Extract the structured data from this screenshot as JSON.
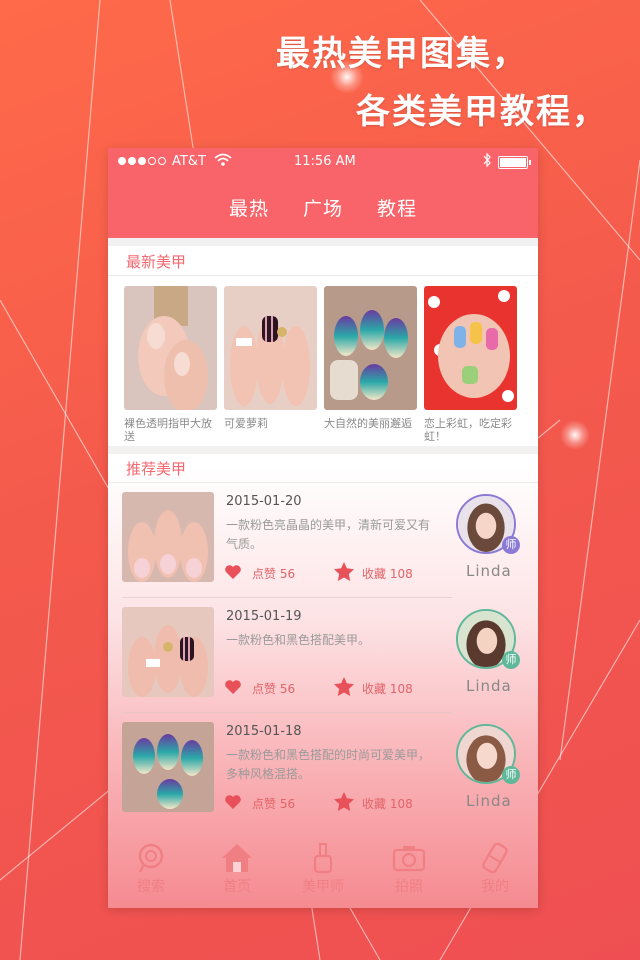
{
  "slogan": {
    "line1": "最热美甲图集，",
    "line2": "各类美甲教程，"
  },
  "status_bar": {
    "carrier": "AT&T",
    "time": "11:56 AM"
  },
  "top_tabs": [
    "最热",
    "广场",
    "教程"
  ],
  "latest": {
    "title": "最新美甲",
    "items": [
      {
        "caption": "裸色透明指甲大放送"
      },
      {
        "caption": "可爱萝莉"
      },
      {
        "caption": "大自然的美丽邂逅"
      },
      {
        "caption": "恋上彩虹，吃定彩虹！"
      }
    ]
  },
  "recommended": {
    "title": "推荐美甲",
    "items": [
      {
        "date": "2015-01-20",
        "desc": "一款粉色亮晶晶的美甲，清新可爱又有气质。",
        "likes": "点赞 56",
        "favorites": "收藏 108",
        "user": "Linda",
        "badge": "师",
        "badge_color": "#8a7ad6"
      },
      {
        "date": "2015-01-19",
        "desc": "一款粉色和黑色搭配美甲。",
        "likes": "点赞 56",
        "favorites": "收藏 108",
        "user": "Linda",
        "badge": "师",
        "badge_color": "#5fb89a"
      },
      {
        "date": "2015-01-18",
        "desc": "一款粉色和黑色搭配的时尚可爱美甲，多种风格混搭。",
        "likes": "点赞 56",
        "favorites": "收藏 108",
        "user": "Linda",
        "badge": "师",
        "badge_color": "#5fb89a"
      }
    ]
  },
  "bottom_nav": [
    {
      "label": "搜索",
      "icon": "search-icon"
    },
    {
      "label": "首页",
      "icon": "home-icon"
    },
    {
      "label": "美甲师",
      "icon": "nail-polish-icon"
    },
    {
      "label": "拍照",
      "icon": "camera-icon"
    },
    {
      "label": "我的",
      "icon": "profile-icon"
    }
  ],
  "colors": {
    "accent": "#f8646a",
    "background": "#f45a4c"
  }
}
